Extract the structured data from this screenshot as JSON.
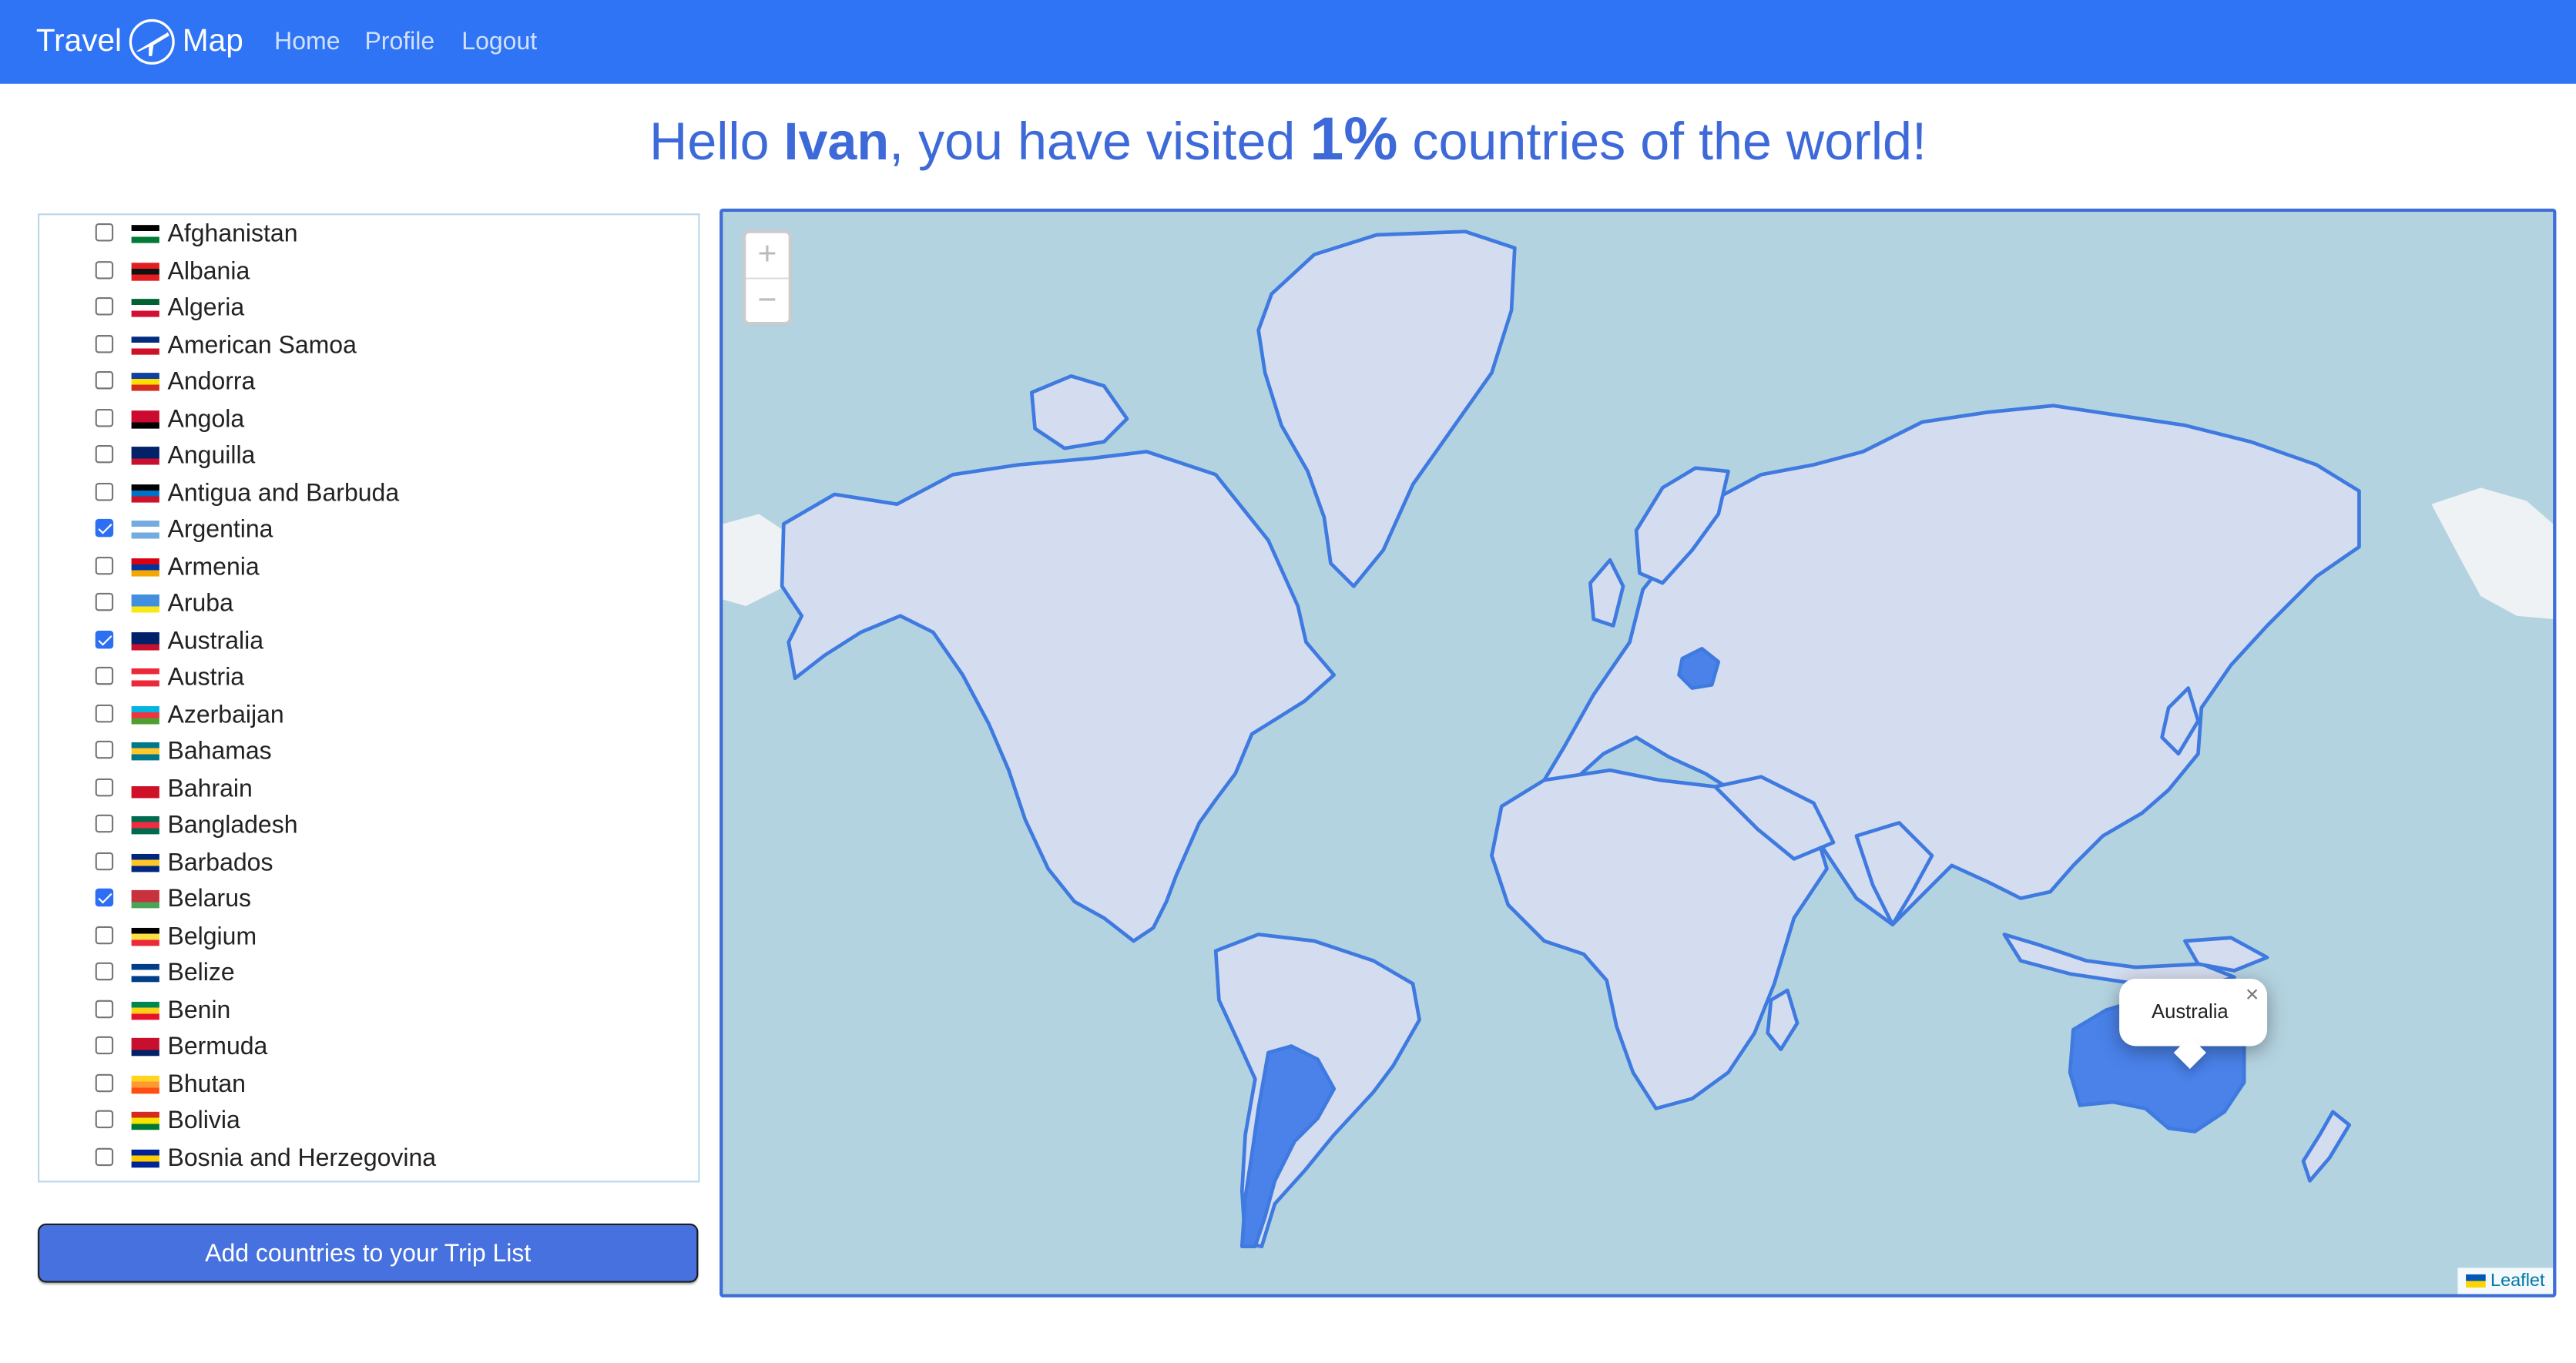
{
  "nav": {
    "brand_left": "Travel",
    "brand_right": "Map",
    "links": [
      "Home",
      "Profile",
      "Logout"
    ]
  },
  "headline": {
    "hello": "Hello ",
    "name": "Ivan",
    "middle": ", you have visited ",
    "percent": "1%",
    "end": " countries of the world!"
  },
  "countries": [
    {
      "name": "Afghanistan",
      "checked": false
    },
    {
      "name": "Albania",
      "checked": false
    },
    {
      "name": "Algeria",
      "checked": false
    },
    {
      "name": "American Samoa",
      "checked": false
    },
    {
      "name": "Andorra",
      "checked": false
    },
    {
      "name": "Angola",
      "checked": false
    },
    {
      "name": "Anguilla",
      "checked": false
    },
    {
      "name": "Antigua and Barbuda",
      "checked": false
    },
    {
      "name": "Argentina",
      "checked": true
    },
    {
      "name": "Armenia",
      "checked": false
    },
    {
      "name": "Aruba",
      "checked": false
    },
    {
      "name": "Australia",
      "checked": true
    },
    {
      "name": "Austria",
      "checked": false
    },
    {
      "name": "Azerbaijan",
      "checked": false
    },
    {
      "name": "Bahamas",
      "checked": false
    },
    {
      "name": "Bahrain",
      "checked": false
    },
    {
      "name": "Bangladesh",
      "checked": false
    },
    {
      "name": "Barbados",
      "checked": false
    },
    {
      "name": "Belarus",
      "checked": true
    },
    {
      "name": "Belgium",
      "checked": false
    },
    {
      "name": "Belize",
      "checked": false
    },
    {
      "name": "Benin",
      "checked": false
    },
    {
      "name": "Bermuda",
      "checked": false
    },
    {
      "name": "Bhutan",
      "checked": false
    },
    {
      "name": "Bolivia",
      "checked": false
    },
    {
      "name": "Bosnia and Herzegovina",
      "checked": false
    }
  ],
  "add_button": "Add countries to your Trip List",
  "map": {
    "popup": "Australia",
    "popup_close": "×",
    "zoom_in": "+",
    "zoom_out": "−",
    "attribution": "Leaflet",
    "visited": [
      "Argentina",
      "Australia",
      "Belarus"
    ]
  },
  "colors": {
    "navbar": "#2f74f5",
    "headline": "#3d6ad8",
    "button": "#4671de",
    "country_fill": "#d4dcef",
    "border": "#3f7ae0",
    "visited_fill": "#4a82ea",
    "water": "#b4d3e0"
  }
}
